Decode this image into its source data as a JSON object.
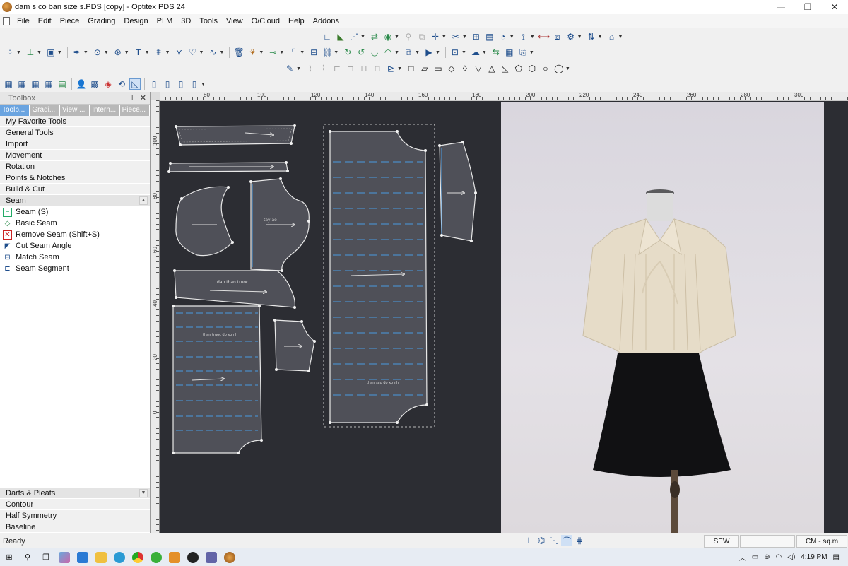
{
  "window": {
    "title": "dam s co ban size s.PDS [copy] - Optitex PDS 24",
    "controls": [
      "—",
      "❐",
      "✕"
    ]
  },
  "menu": [
    "File",
    "Edit",
    "Piece",
    "Grading",
    "Design",
    "PLM",
    "3D",
    "Tools",
    "View",
    "O/Cloud",
    "Help",
    "Addons"
  ],
  "toolbox": {
    "title": "Toolbox",
    "pin": "⊥",
    "close": "✕",
    "tabs": [
      "Toolb...",
      "Gradi...",
      "View ...",
      "Intern...",
      "Piece..."
    ],
    "categories_top": [
      "My Favorite Tools",
      "General Tools",
      "Import",
      "Movement",
      "Rotation",
      "Points & Notches",
      "Build & Cut"
    ],
    "open_category": "Seam",
    "seam_tools": [
      "Seam (S)",
      "Basic Seam",
      "Remove Seam (Shift+S)",
      "Cut Seam Angle",
      "Match Seam",
      "Seam Segment"
    ],
    "categories_bottom": [
      "Darts & Pleats",
      "Contour",
      "Half Symmetry",
      "Baseline"
    ]
  },
  "ruler": {
    "h_labels": [
      "80",
      "100",
      "120",
      "140",
      "160",
      "180",
      "200",
      "220",
      "240",
      "260",
      "280",
      "300"
    ],
    "v_labels": [
      "100",
      "80",
      "60",
      "40",
      "20",
      "0"
    ]
  },
  "pieces": {
    "label_front": "dap than truoc",
    "label_back": "than truoc do xo nh",
    "label_main": "than sau do xo nh",
    "label_sleeve": "tay ao"
  },
  "status": {
    "text": "Ready",
    "mode": "SEW",
    "units": "CM - sq.m"
  },
  "taskbar": {
    "time": "4:19 PM"
  },
  "colors": {
    "canvas": "#2c2d33",
    "seam_line": "#4a9ae0",
    "piece_fill": "#4f5058",
    "active_tab": "#6aa4e0"
  }
}
